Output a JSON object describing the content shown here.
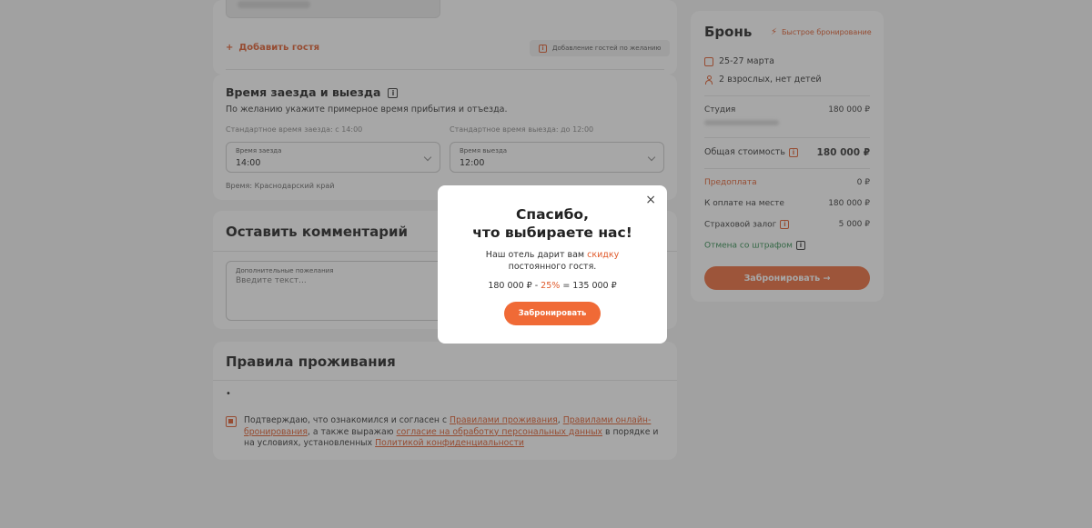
{
  "guests": {
    "add_guest_label": "Добавить гостя",
    "add_guest_plus": "+",
    "hint_chip": "Добавление гостей по желанию"
  },
  "time": {
    "title": "Время заезда и выезда",
    "description": "По желанию укажите примерное время прибытия и отъезда.",
    "checkin_std": "Стандартное время заезда: с 14:00",
    "checkout_std": "Стандартное время выезда: до 12:00",
    "checkin_label": "Время заезда",
    "checkin_value": "14:00",
    "checkout_label": "Время выезда",
    "checkout_value": "12:00",
    "timezone_note": "Время: Краснодарский край"
  },
  "comment": {
    "title": "Оставить комментарий",
    "field_label": "Дополнительные пожелания",
    "placeholder": "Введите текст..."
  },
  "rules": {
    "title": "Правила проживания",
    "bullet": "•",
    "consent_prefix": "Подтверждаю, что ознакомился и согласен с ",
    "link_rules": "Правилами проживания",
    "comma": ", ",
    "link_online": "Правилами онлайн-бронирования",
    "consent_mid": ", а также выражаю ",
    "link_consent": "согласие на обработку персональных данных",
    "consent_mid2": " в порядке и на условиях, установленных ",
    "link_privacy": "Политикой конфиденциальности"
  },
  "booking": {
    "title": "Бронь",
    "fast_booking": "Быстрое бронирование",
    "dates": "25-27 марта",
    "guests": "2 взрослых, нет детей",
    "room_name": "Студия",
    "room_price": "180 000 ₽",
    "total_label": "Общая стоимость",
    "total_value": "180 000 ₽",
    "prepay_label": "Предоплата",
    "prepay_value": "0 ₽",
    "onsite_label": "К оплате на месте",
    "onsite_value": "180 000 ₽",
    "deposit_label": "Страховой залог",
    "deposit_value": "5 000 ₽",
    "cancel_label": "Отмена со штрафом",
    "book_button": "Забронировать →"
  },
  "modal": {
    "title_line1": "Спасибо,",
    "title_line2": "что выбираете нас!",
    "body_prefix": "Наш отель дарит вам ",
    "body_accent": "скидку",
    "body_suffix": "постоянного гостя.",
    "calc_base": "180 000 ₽ - ",
    "calc_discount": "25%",
    "calc_result": " = 135 000 ₽",
    "button": "Забронировать",
    "close": "×"
  },
  "colors": {
    "accent": "#e05a2b",
    "button": "#ed6a3a",
    "success": "#2e8b4e",
    "overlay": "rgba(60,60,60,0.45)"
  }
}
